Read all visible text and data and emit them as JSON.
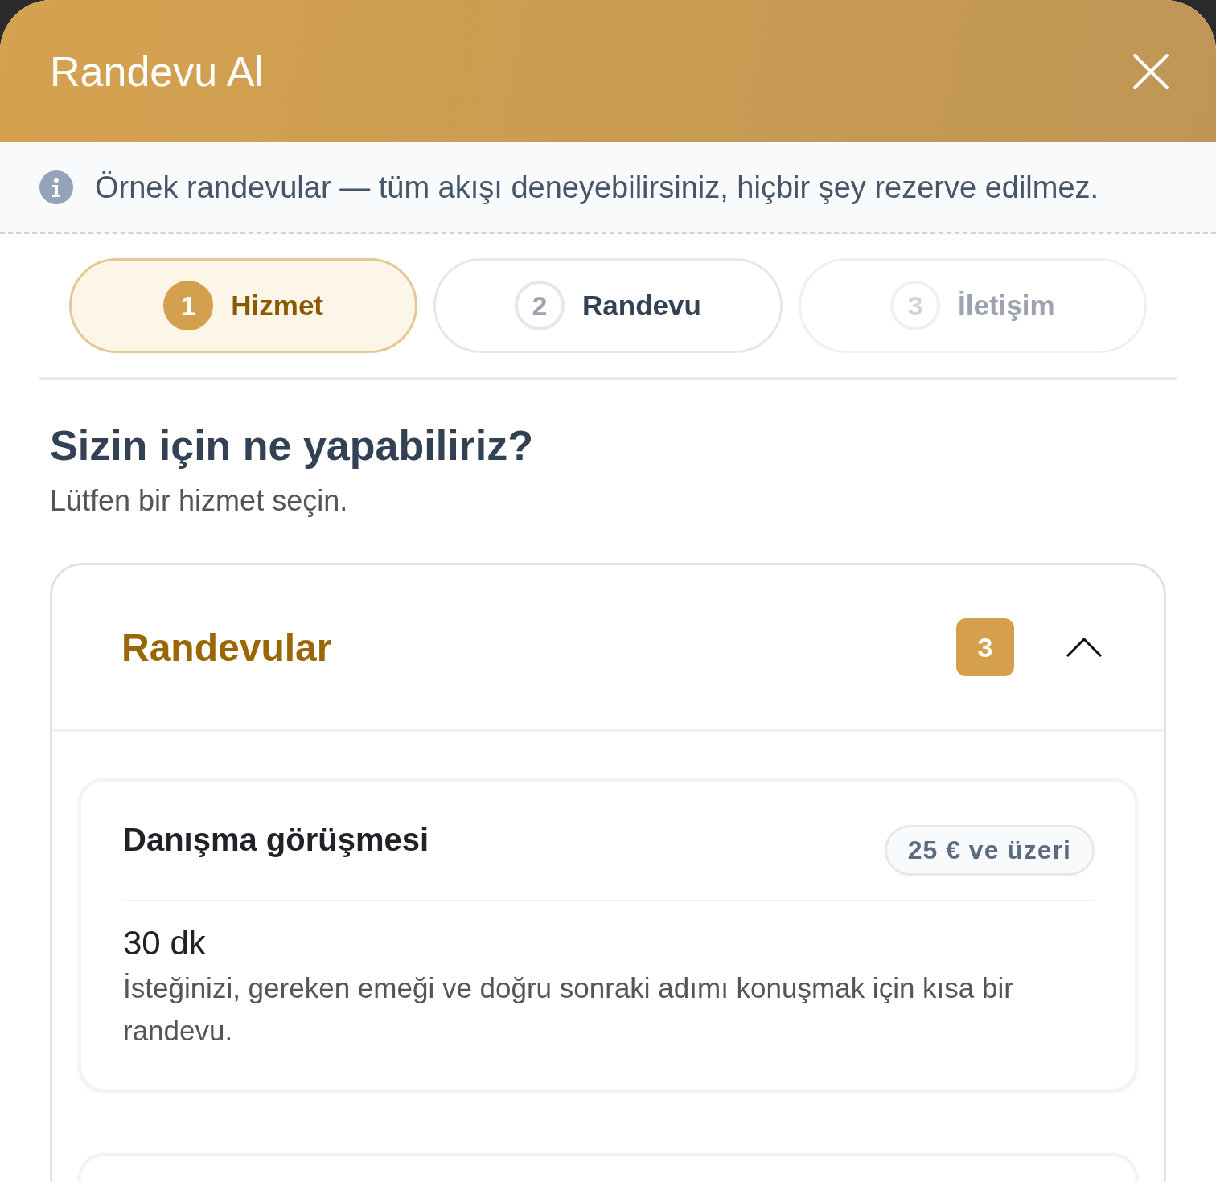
{
  "dialog": {
    "title": "Randevu Al"
  },
  "notice": "Örnek randevular — tüm akışı deneyebilirsiniz, hiçbir şey rezerve edilmez.",
  "steps": [
    {
      "number": "1",
      "label": "Hizmet",
      "selected": true,
      "disabled": false
    },
    {
      "number": "2",
      "label": "Randevu",
      "selected": false,
      "disabled": false
    },
    {
      "number": "3",
      "label": "İletişim",
      "selected": false,
      "disabled": true
    }
  ],
  "heading": "Sizin için ne yapabiliriz?",
  "subheading": "Lütfen bir hizmet seçin.",
  "category": {
    "title": "Randevular",
    "count": "3",
    "expanded": true,
    "services": [
      {
        "name": "Danışma görüşmesi",
        "price": "25 € ve üzeri",
        "duration": "30 dk",
        "description": "İsteğinizi, gereken emeği ve doğru sonraki adımı konuşmak için kısa bir randevu."
      }
    ]
  }
}
